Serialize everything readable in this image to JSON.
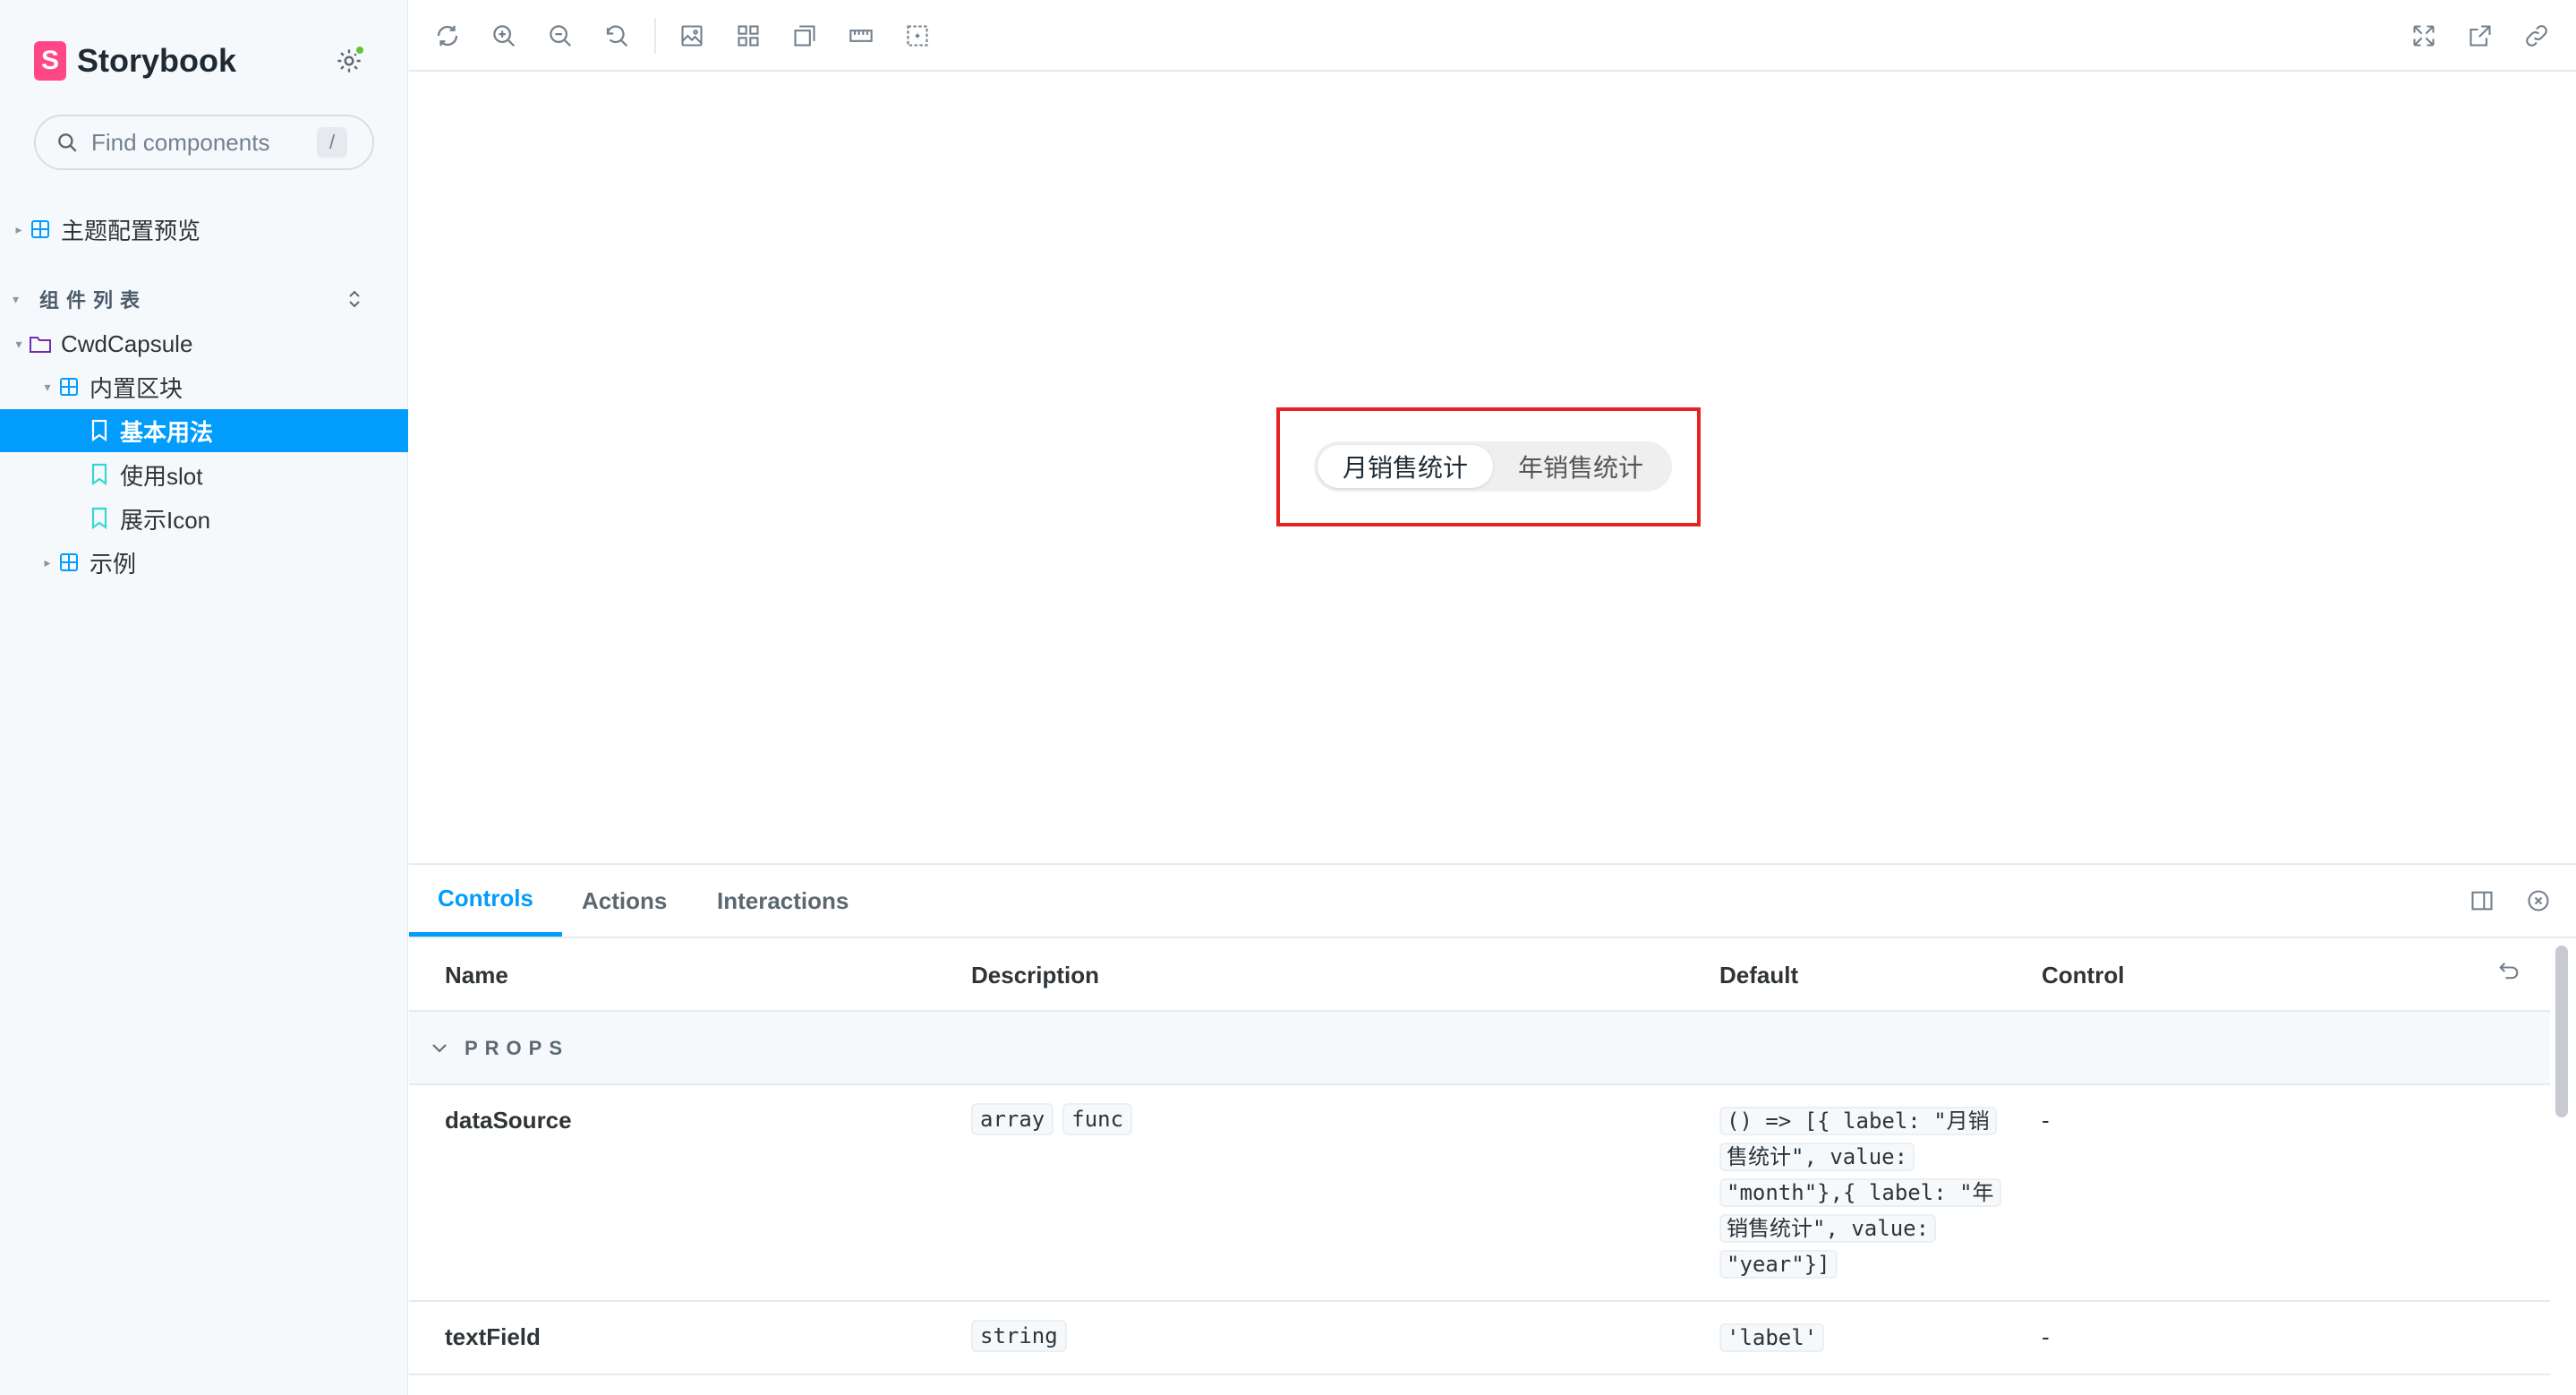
{
  "app": {
    "brand": "Storybook",
    "logo_letter": "S"
  },
  "search": {
    "placeholder": "Find components",
    "shortcut": "/"
  },
  "sidebar": {
    "top_items": [
      {
        "label": "主题配置预览",
        "icon": "component-icon"
      }
    ],
    "section_title": "组件列表",
    "tree": [
      {
        "label": "CwdCapsule",
        "icon": "folder-icon",
        "level": 0
      },
      {
        "label": "内置区块",
        "icon": "component-icon",
        "level": 1
      },
      {
        "label": "基本用法",
        "icon": "bookmark-icon",
        "level": 2,
        "selected": true
      },
      {
        "label": "使用slot",
        "icon": "bookmark-icon",
        "level": 2
      },
      {
        "label": "展示Icon",
        "icon": "bookmark-icon",
        "level": 2
      },
      {
        "label": "示例",
        "icon": "component-icon",
        "level": 1
      }
    ]
  },
  "toolbar": {
    "tools": [
      "reload-icon",
      "zoom-in-icon",
      "zoom-out-icon",
      "zoom-reset-icon",
      "background-icon",
      "grid-icon",
      "viewport-icon",
      "measure-icon",
      "outline-icon"
    ],
    "right_tools": [
      "fullscreen-icon",
      "open-new-tab-icon",
      "copy-link-icon"
    ]
  },
  "canvas": {
    "capsule": {
      "items": [
        "月销售统计",
        "年销售统计"
      ],
      "active_index": 0
    }
  },
  "panel": {
    "tabs": [
      "Controls",
      "Actions",
      "Interactions"
    ],
    "active_tab": "Controls",
    "columns": {
      "name": "Name",
      "description": "Description",
      "default": "Default",
      "control": "Control"
    },
    "group_label": "PROPS",
    "rows": [
      {
        "name": "dataSource",
        "types": [
          "array",
          "func"
        ],
        "default": "() => [{ label: \"月销售统计\", value: \"month\"},{ label: \"年销售统计\", value: \"year\"}]",
        "control": "-"
      },
      {
        "name": "textField",
        "types": [
          "string"
        ],
        "default": "'label'",
        "control": "-"
      }
    ]
  },
  "colors": {
    "accent": "#029cfd",
    "brand": "#ff4785",
    "highlight_border": "#e52421"
  }
}
